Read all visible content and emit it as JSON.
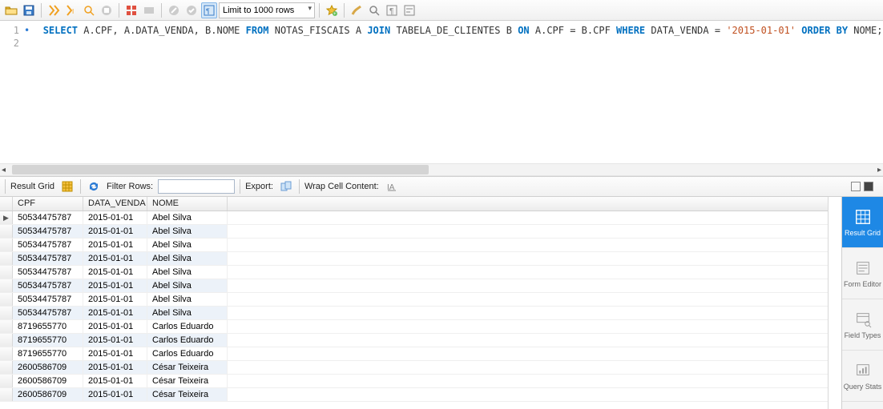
{
  "toolbar": {
    "limit_label": "Limit to 1000 rows"
  },
  "panel": {
    "result_grid_label": "Result Grid",
    "filter_rows_label": "Filter Rows:",
    "filter_value": "",
    "export_label": "Export:",
    "wrap_label": "Wrap Cell Content:"
  },
  "sql": {
    "tokens": [
      {
        "t": "SELECT",
        "c": "kw"
      },
      {
        "t": " A.CPF",
        "c": "ident"
      },
      {
        "t": ",",
        "c": "punct"
      },
      {
        "t": " A.DATA_VENDA",
        "c": "ident"
      },
      {
        "t": ",",
        "c": "punct"
      },
      {
        "t": " B.NOME",
        "c": "ident"
      },
      {
        "t": " FROM",
        "c": "kw"
      },
      {
        "t": " NOTAS_FISCAIS A ",
        "c": "ident"
      },
      {
        "t": "JOIN",
        "c": "kw"
      },
      {
        "t": " TABELA_DE_CLIENTES B ",
        "c": "ident"
      },
      {
        "t": "ON",
        "c": "kw"
      },
      {
        "t": " A.CPF ",
        "c": "ident"
      },
      {
        "t": "=",
        "c": "punct"
      },
      {
        "t": " B.CPF ",
        "c": "ident"
      },
      {
        "t": "WHERE",
        "c": "kw"
      },
      {
        "t": " DATA_VENDA ",
        "c": "ident"
      },
      {
        "t": "=",
        "c": "punct"
      },
      {
        "t": " ",
        "c": "punct"
      },
      {
        "t": "'2015-01-01'",
        "c": "str"
      },
      {
        "t": " ORDER BY",
        "c": "kw"
      },
      {
        "t": " NOME",
        "c": "ident"
      },
      {
        "t": ";",
        "c": "punct"
      }
    ]
  },
  "columns": {
    "cpf": "CPF",
    "data_venda": "DATA_VENDA",
    "nome": "NOME"
  },
  "rows": [
    {
      "cpf": "50534475787",
      "dv": "2015-01-01",
      "nome": "Abel Silva",
      "current": true
    },
    {
      "cpf": "50534475787",
      "dv": "2015-01-01",
      "nome": "Abel Silva"
    },
    {
      "cpf": "50534475787",
      "dv": "2015-01-01",
      "nome": "Abel Silva"
    },
    {
      "cpf": "50534475787",
      "dv": "2015-01-01",
      "nome": "Abel Silva"
    },
    {
      "cpf": "50534475787",
      "dv": "2015-01-01",
      "nome": "Abel Silva"
    },
    {
      "cpf": "50534475787",
      "dv": "2015-01-01",
      "nome": "Abel Silva"
    },
    {
      "cpf": "50534475787",
      "dv": "2015-01-01",
      "nome": "Abel Silva"
    },
    {
      "cpf": "50534475787",
      "dv": "2015-01-01",
      "nome": "Abel Silva"
    },
    {
      "cpf": "8719655770",
      "dv": "2015-01-01",
      "nome": "Carlos Eduardo"
    },
    {
      "cpf": "8719655770",
      "dv": "2015-01-01",
      "nome": "Carlos Eduardo"
    },
    {
      "cpf": "8719655770",
      "dv": "2015-01-01",
      "nome": "Carlos Eduardo"
    },
    {
      "cpf": "2600586709",
      "dv": "2015-01-01",
      "nome": "César Teixeira"
    },
    {
      "cpf": "2600586709",
      "dv": "2015-01-01",
      "nome": "César Teixeira"
    },
    {
      "cpf": "2600586709",
      "dv": "2015-01-01",
      "nome": "César Teixeira"
    }
  ],
  "sidepanel": {
    "result_grid": "Result\nGrid",
    "form_editor": "Form\nEditor",
    "field_types": "Field\nTypes",
    "query_stats": "Query\nStats"
  }
}
